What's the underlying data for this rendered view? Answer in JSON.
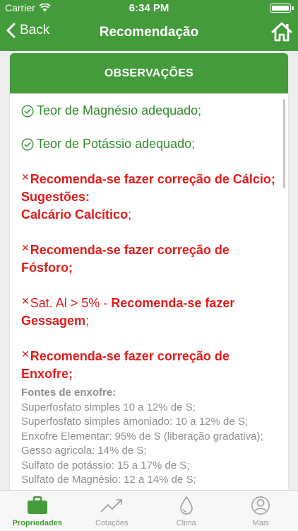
{
  "status_bar": {
    "carrier": "Carrier",
    "time": "6:34 PM"
  },
  "nav": {
    "back_label": "Back",
    "title": "Recomendação"
  },
  "card": {
    "title": "OBSERVAÇÕES",
    "ok_items": [
      "Teor de Magnésio adequado;",
      "Teor de Potássio adequado;"
    ],
    "calcio": {
      "prefix": "Recomenda-se fazer correção de Cálcio; Sugestões:",
      "bold_suffix": "Calcário Calcítico",
      "end": ";"
    },
    "fosforo": {
      "text": "Recomenda-se fazer correção de Fósforo;"
    },
    "gessagem": {
      "plain": "Sat. Al > 5% - ",
      "bold": "Recomenda-se fazer Gessagem",
      "end": ";"
    },
    "enxofre": {
      "text": "Recomenda-se fazer correção de Enxofre;"
    },
    "fontes": {
      "title": "Fontes de enxofre:",
      "lines": [
        "Superfosfato simples 10 a 12% de S;",
        "Superfosfato simples amoniado: 10 a 12% de S;",
        "Enxofre Elementar: 95% de S (liberação gradativa);",
        "Gesso agricola: 14% de S;",
        "Sulfato de potássio: 15 a 17% de S;",
        "Sulfato de Magnésio: 12 a 14% de S;"
      ]
    }
  },
  "tabs": [
    {
      "label": "Propriedades",
      "icon": "briefcase-icon",
      "active": true
    },
    {
      "label": "Cotações",
      "icon": "trend-chart-icon",
      "active": false
    },
    {
      "label": "Clima",
      "icon": "water-drop-icon",
      "active": false
    },
    {
      "label": "Mais",
      "icon": "user-circle-icon",
      "active": false
    }
  ],
  "colors": {
    "brand_green": "#449b3b",
    "ok_green": "#2e8b2b",
    "alert_red": "#e21b1b",
    "muted_gray": "#8e8e8e"
  }
}
